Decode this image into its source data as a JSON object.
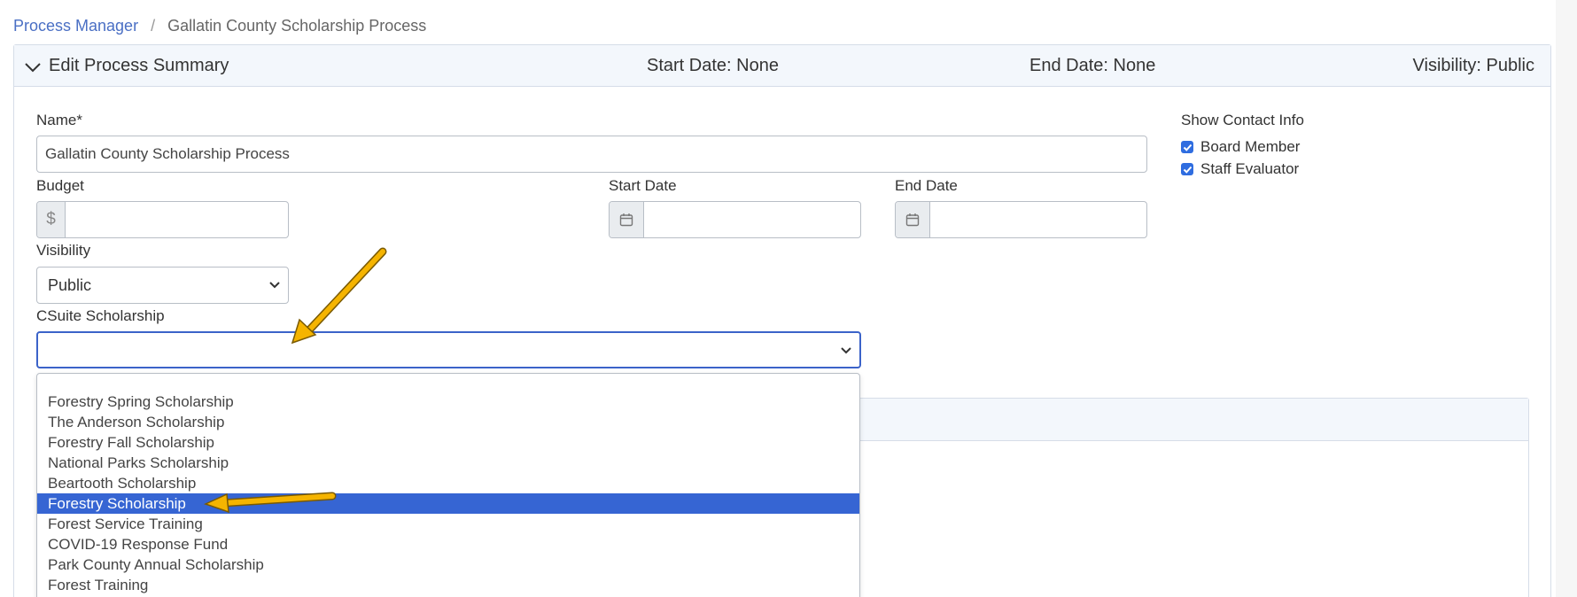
{
  "breadcrumb": {
    "root": "Process Manager",
    "separator": "/",
    "current": "Gallatin County Scholarship Process"
  },
  "header": {
    "title": "Edit Process Summary",
    "start_date": "Start Date: None",
    "end_date": "End Date: None",
    "visibility": "Visibility: Public"
  },
  "form": {
    "name_label": "Name*",
    "name_value": "Gallatin County Scholarship Process",
    "budget_label": "Budget",
    "budget_prefix": "$",
    "budget_value": "",
    "start_date_label": "Start Date",
    "end_date_label": "End Date",
    "visibility_label": "Visibility",
    "visibility_value": "Public",
    "csuite_label": "CSuite Scholarship",
    "csuite_value": ""
  },
  "contact": {
    "title": "Show Contact Info",
    "options": [
      {
        "label": "Board Member",
        "checked": true
      },
      {
        "label": "Staff Evaluator",
        "checked": true
      }
    ]
  },
  "dropdown": {
    "options": [
      "",
      "Forestry Spring Scholarship",
      "The Anderson Scholarship",
      "Forestry Fall Scholarship",
      "National Parks Scholarship",
      "Beartooth Scholarship",
      "Forestry Scholarship",
      "Forest Service Training",
      "COVID-19 Response Fund",
      "Park County Annual Scholarship",
      "Forest Training"
    ],
    "highlighted": "Forestry Scholarship"
  },
  "colors": {
    "accent": "#3665d3",
    "link": "#4a6fc4",
    "annotation_arrow": "#f5b400"
  },
  "icons": {
    "collapse": "chevron-down-icon",
    "calendar": "calendar-icon",
    "select": "chevron-down-icon",
    "checkbox": "checkmark-icon"
  }
}
